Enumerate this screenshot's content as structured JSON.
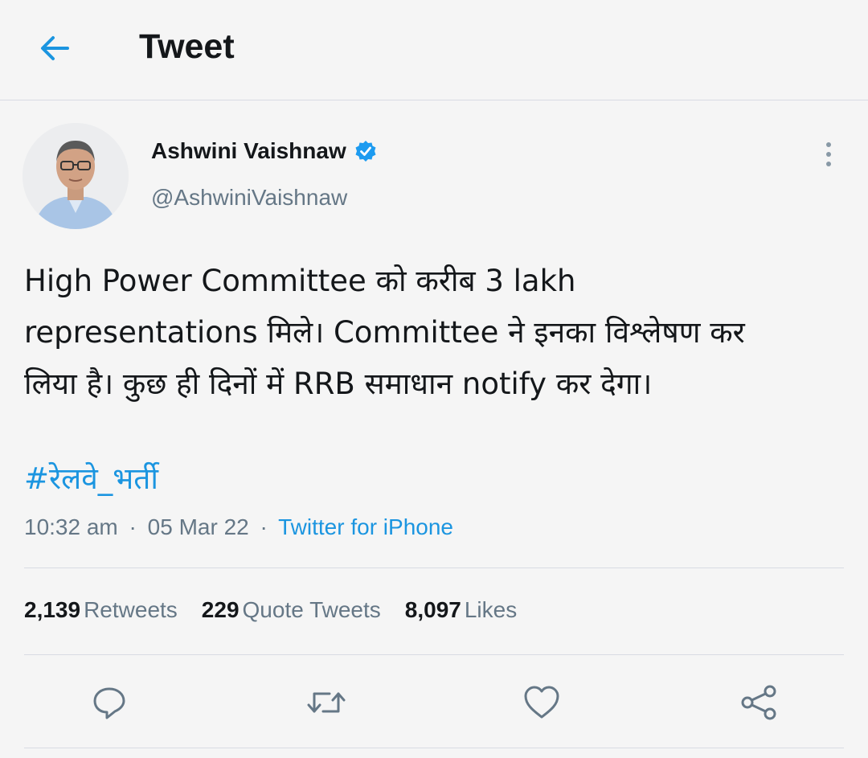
{
  "header": {
    "title": "Tweet",
    "back_icon": "arrow-left-icon"
  },
  "author": {
    "name": "Ashwini Vaishnaw",
    "handle": "@AshwiniVaishnaw",
    "verified": true
  },
  "tweet": {
    "text_lines": [
      "High Power Committee को करीब 3 lakh",
      "representations मिले। Committee ने इनका विश्लेषण कर",
      "लिया है। कुछ ही दिनों में RRB समाधान notify कर देगा।"
    ],
    "hashtag": "#रेलवे_भर्ती",
    "time": "10:32 am",
    "date": "05 Mar 22",
    "separator": "·",
    "source": "Twitter for iPhone"
  },
  "stats": {
    "retweets_count": "2,139",
    "retweets_label": "Retweets",
    "quotes_count": "229",
    "quotes_label": "Quote Tweets",
    "likes_count": "8,097",
    "likes_label": "Likes"
  },
  "actions": [
    "reply-icon",
    "retweet-icon",
    "like-icon",
    "share-icon"
  ],
  "colors": {
    "accent": "#1b95e0",
    "text": "#14171a",
    "secondary": "#657786",
    "background": "#f5f5f5",
    "divider": "#d8dbe3"
  }
}
